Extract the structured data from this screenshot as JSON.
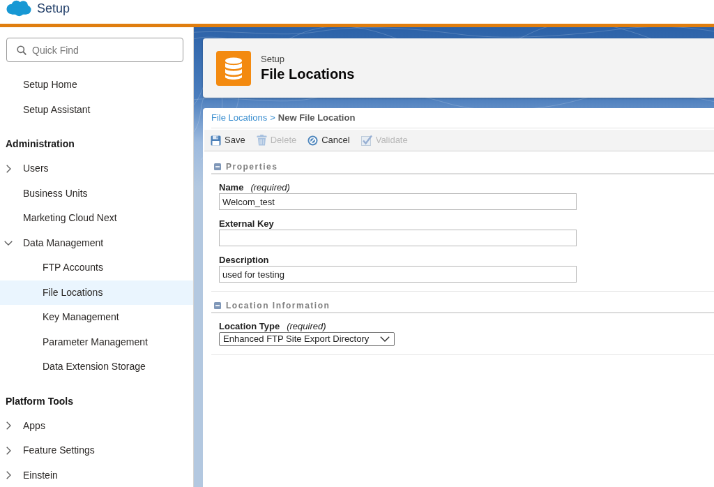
{
  "header": {
    "title": "Setup"
  },
  "sidebar": {
    "search": {
      "placeholder": "Quick Find"
    },
    "sections": [
      {
        "items": [
          {
            "label": "Setup Home",
            "kind": "link",
            "selected": false
          },
          {
            "label": "Setup Assistant",
            "kind": "link",
            "selected": false
          }
        ]
      },
      {
        "heading": "Administration",
        "items": [
          {
            "label": "Users",
            "kind": "group",
            "expanded": false,
            "selected": false
          },
          {
            "label": "Business Units",
            "kind": "link",
            "selected": false
          },
          {
            "label": "Marketing Cloud Next",
            "kind": "link",
            "selected": false
          },
          {
            "label": "Data Management",
            "kind": "group",
            "expanded": true,
            "selected": false,
            "children": [
              {
                "label": "FTP Accounts",
                "kind": "link",
                "selected": false
              },
              {
                "label": "File Locations",
                "kind": "link",
                "selected": true
              },
              {
                "label": "Key Management",
                "kind": "link",
                "selected": false
              },
              {
                "label": "Parameter Management",
                "kind": "link",
                "selected": false
              },
              {
                "label": "Data Extension Storage",
                "kind": "link",
                "selected": false
              }
            ]
          }
        ]
      },
      {
        "heading": "Platform Tools",
        "items": [
          {
            "label": "Apps",
            "kind": "group",
            "expanded": false,
            "selected": false
          },
          {
            "label": "Feature Settings",
            "kind": "group",
            "expanded": false,
            "selected": false
          },
          {
            "label": "Einstein",
            "kind": "group",
            "expanded": false,
            "selected": false
          }
        ]
      }
    ]
  },
  "page_header": {
    "eyebrow": "Setup",
    "title": "File Locations"
  },
  "breadcrumb": {
    "parent": "File Locations",
    "separator": ">",
    "current": "New File Location"
  },
  "toolbar": [
    {
      "kind": "save",
      "label": "Save",
      "disabled": false
    },
    {
      "kind": "delete",
      "label": "Delete",
      "disabled": true
    },
    {
      "kind": "cancel",
      "label": "Cancel",
      "disabled": false
    },
    {
      "kind": "validate",
      "label": "Validate",
      "disabled": true
    }
  ],
  "sections": [
    {
      "title": "Properties",
      "expanded": true,
      "fields": [
        {
          "kind": "text",
          "label": "Name",
          "note": "(required)",
          "value": "Welcom_test"
        },
        {
          "kind": "text",
          "label": "External Key"
        },
        {
          "kind": "text",
          "label": "Description",
          "value": "used for testing"
        }
      ]
    },
    {
      "title": "Location Information",
      "expanded": true,
      "fields": [
        {
          "kind": "select",
          "label": "Location Type",
          "note": "(required)",
          "value": "Enhanced FTP Site Export Directory"
        }
      ]
    }
  ]
}
